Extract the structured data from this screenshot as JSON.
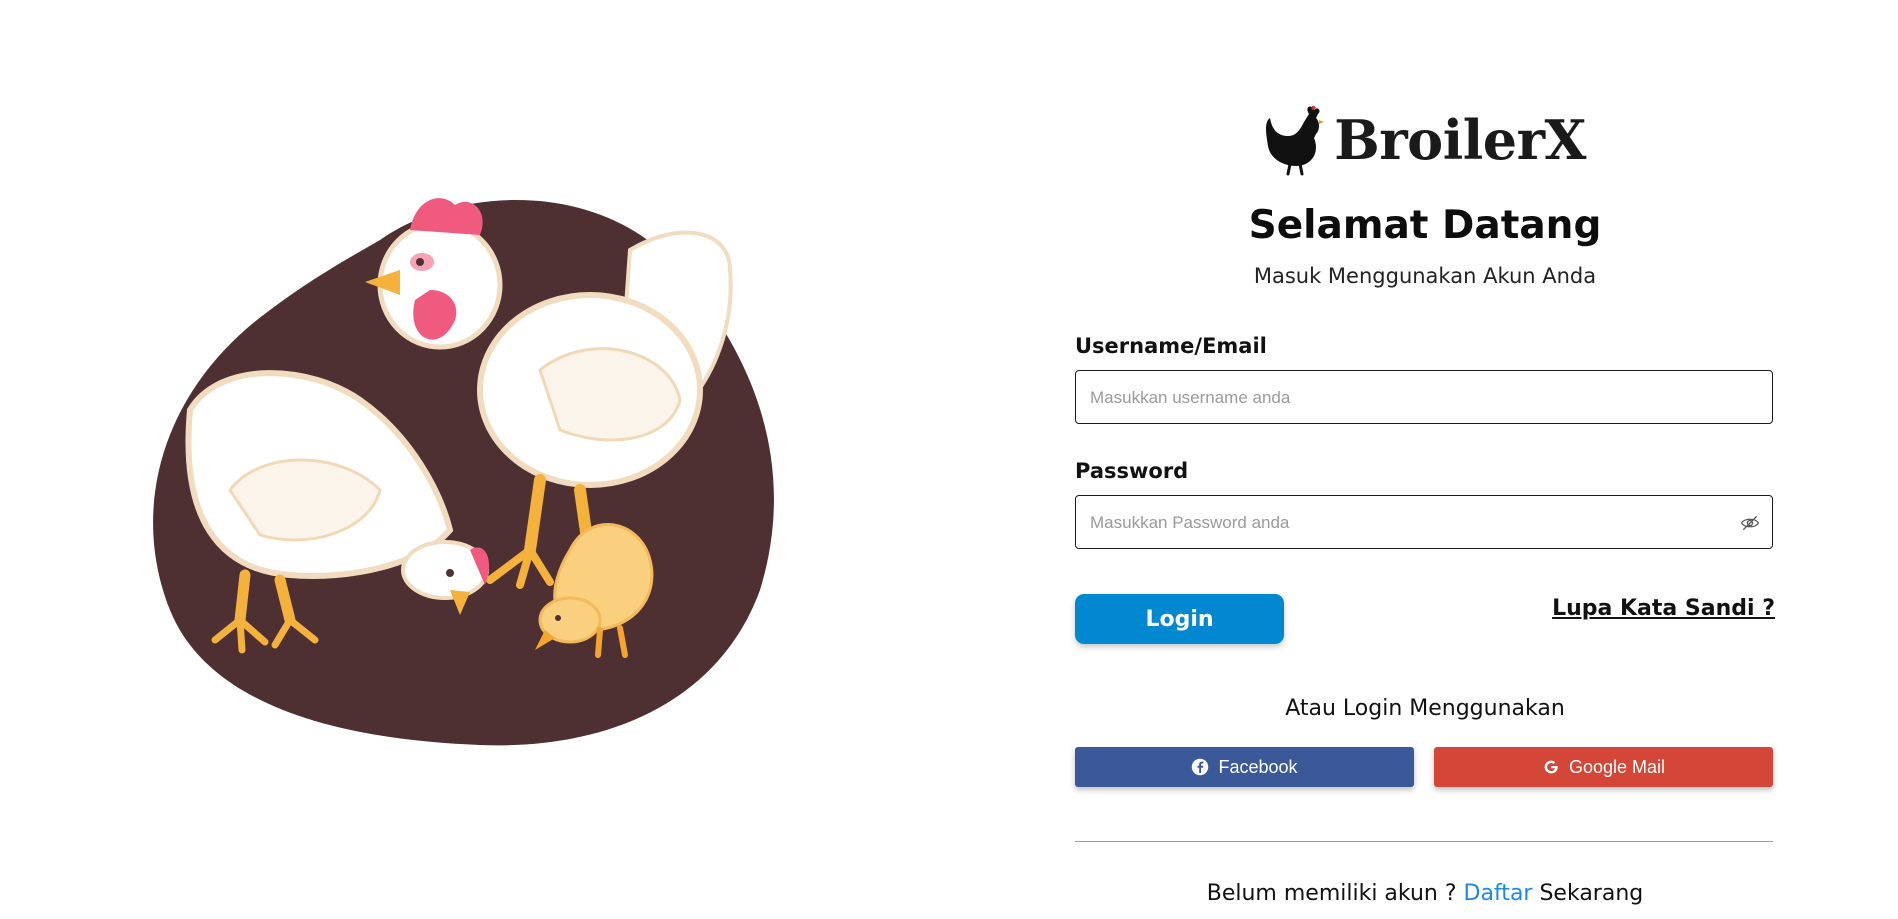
{
  "brand": {
    "name": "BroilerX",
    "logo_icon": "chicken-icon"
  },
  "header": {
    "title": "Selamat Datang",
    "subtitle": "Masuk Menggunakan Akun Anda"
  },
  "form": {
    "username_label": "Username/Email",
    "username_placeholder": "Masukkan username anda",
    "username_value": "",
    "password_label": "Password",
    "password_placeholder": "Masukkan Password anda",
    "password_value": "",
    "password_toggle_icon": "eye-slash-icon",
    "login_label": "Login",
    "forgot_label": "Lupa Kata Sandi ?"
  },
  "social": {
    "heading": "Atau Login Menggunakan",
    "facebook_label": "Facebook",
    "facebook_icon": "facebook-icon",
    "google_label": "Google Mail",
    "google_icon": "google-icon"
  },
  "signup": {
    "prefix": "Belum memiliki akun ? ",
    "link": "Daftar",
    "suffix": " Sekarang"
  },
  "colors": {
    "primary": "#0288d1",
    "facebook": "#3b5998",
    "google": "#d44638",
    "link": "#1e88e5",
    "blob": "#4e3033"
  }
}
